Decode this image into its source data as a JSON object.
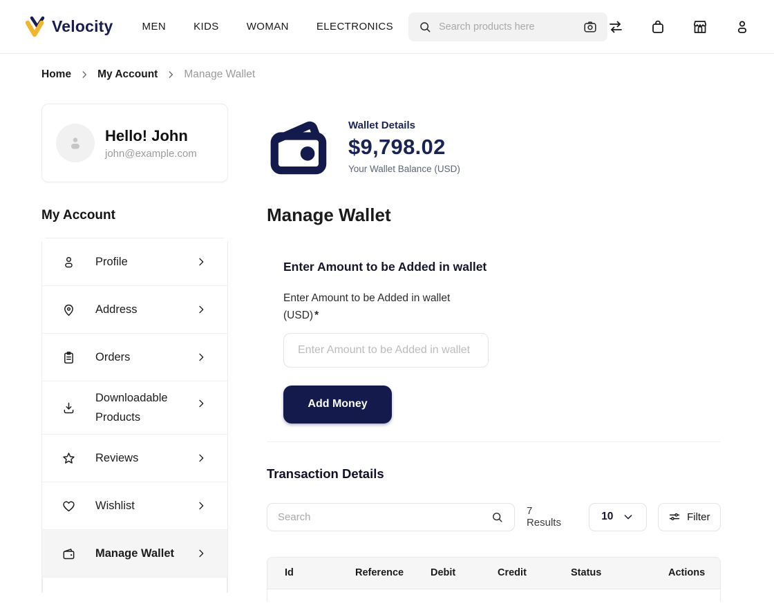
{
  "brand": {
    "name": "Velocity",
    "accent_yellow": "#f2b52d",
    "navy": "#141a4b"
  },
  "nav": {
    "items": [
      "MEN",
      "KIDS",
      "WOMAN",
      "ELECTRONICS"
    ]
  },
  "header": {
    "search_placeholder": "Search products here"
  },
  "breadcrumb": {
    "items": [
      "Home",
      "My Account",
      "Manage Wallet"
    ]
  },
  "user_card": {
    "greeting": "Hello! John",
    "email": "john@example.com"
  },
  "sidebar": {
    "title": "My Account",
    "items": [
      {
        "label": "Profile",
        "icon": "user-icon"
      },
      {
        "label": "Address",
        "icon": "map-pin-icon"
      },
      {
        "label": "Orders",
        "icon": "clipboard-icon"
      },
      {
        "label": "Downloadable Products",
        "icon": "download-icon"
      },
      {
        "label": "Reviews",
        "icon": "star-icon"
      },
      {
        "label": "Wishlist",
        "icon": "heart-icon"
      },
      {
        "label": "Manage Wallet",
        "icon": "wallet-icon"
      }
    ]
  },
  "wallet_summary": {
    "title": "Wallet Details",
    "balance": "$9,798.02",
    "caption": "Your Wallet Balance (USD)"
  },
  "page": {
    "title": "Manage Wallet"
  },
  "add_money": {
    "section_title": "Enter Amount to be Added in wallet",
    "field_label_line1": "Enter Amount to be Added in wallet",
    "field_label_line2": "(USD)",
    "required_mark": "*",
    "input_placeholder": "Enter Amount to be Added in wallet",
    "button_label": "Add Money"
  },
  "transactions": {
    "title": "Transaction Details",
    "search_placeholder": "Search",
    "results_text": "7 Results",
    "page_size": "10",
    "filter_label": "Filter",
    "columns": [
      "Id",
      "Reference",
      "Debit",
      "Credit",
      "Status",
      "Actions"
    ]
  }
}
